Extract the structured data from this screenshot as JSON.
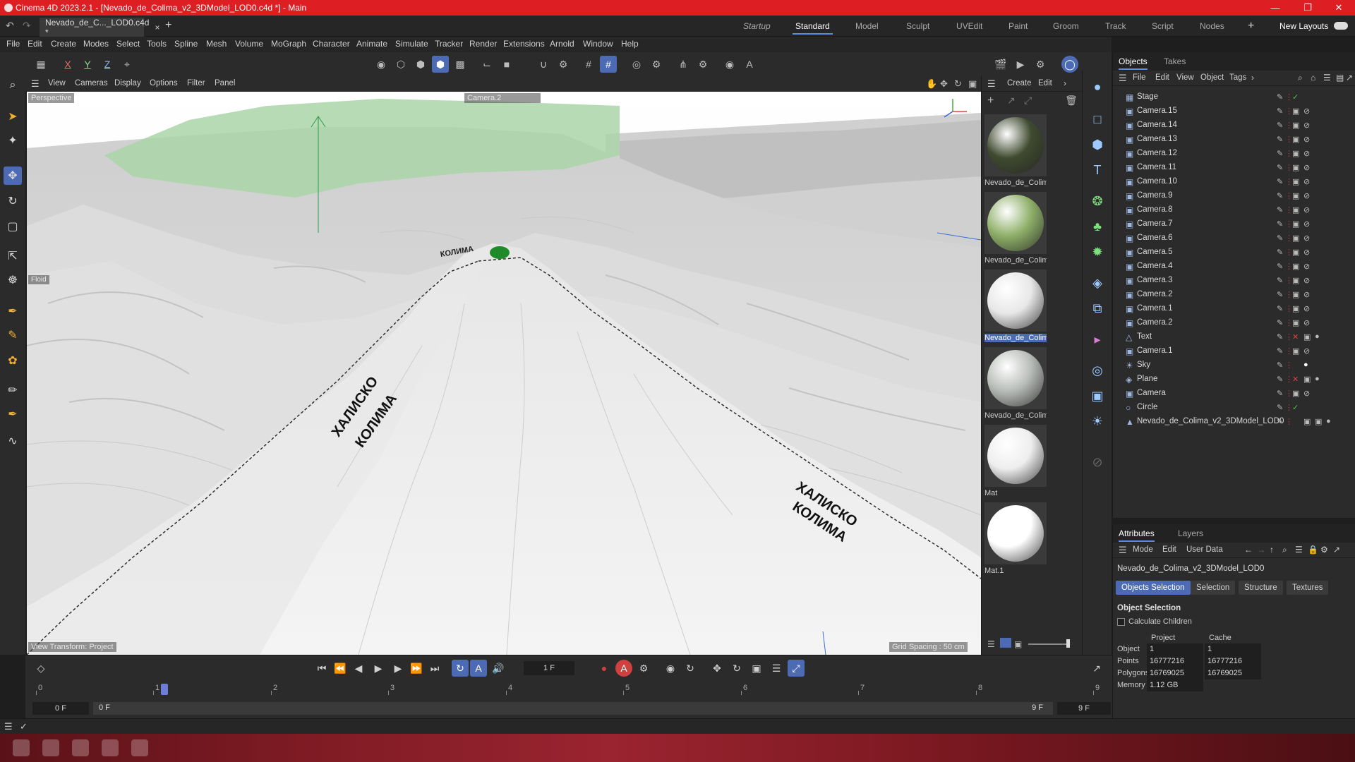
{
  "window": {
    "title": "Cinema 4D 2023.2.1 - [Nevado_de_Colima_v2_3DModel_LOD0.c4d *] - Main",
    "minimize_icon": "minimize-icon",
    "restore_icon": "restore-icon",
    "close_icon": "close-icon"
  },
  "document_tab": {
    "label": "Nevado_de_C..._LOD0.c4d *",
    "close": "×"
  },
  "layouts": {
    "items": [
      "Startup",
      "Standard",
      "Model",
      "Sculpt",
      "UVEdit",
      "Paint",
      "Groom",
      "Track",
      "Script",
      "Nodes"
    ],
    "active": "Standard",
    "add": "+",
    "new_layouts": "New Layouts"
  },
  "menu": [
    "File",
    "Edit",
    "Create",
    "Modes",
    "Select",
    "Tools",
    "Spline",
    "Mesh",
    "Volume",
    "MoGraph",
    "Character",
    "Animate",
    "Simulate",
    "Tracker",
    "Render",
    "Extensions",
    "Arnold",
    "Window",
    "Help"
  ],
  "toolbar": {
    "axis_x": "X",
    "axis_y": "Y",
    "axis_z": "Z"
  },
  "viewport_menu": [
    "View",
    "Cameras",
    "Display",
    "Options",
    "Filter",
    "Panel"
  ],
  "viewport": {
    "view_name": "Perspective",
    "camera_name": "Camera.2",
    "side_label": "Floid",
    "view_transform": "View Transform: Project",
    "grid_spacing": "Grid Spacing : 50 cm",
    "text_left_1": "ХАЛИСКО",
    "text_left_2": "КОЛИМА",
    "text_right_1": "ХАЛИСКО",
    "text_right_2": "КОЛИМА",
    "text_top": "КОЛИМА"
  },
  "material_menu": [
    "Create",
    "Edit"
  ],
  "materials": [
    {
      "name": "Nevado_de_Colim",
      "color": "#3f4a2f",
      "selected": false
    },
    {
      "name": "Nevado_de_Colim",
      "color": "#8fb069",
      "selected": false
    },
    {
      "name": "Nevado_de_Colim",
      "color": "#e8e8e8",
      "selected": true
    },
    {
      "name": "Nevado_de_Colim",
      "color": "#b8bcb8",
      "selected": false
    },
    {
      "name": "Mat",
      "color": "#eeeeee",
      "selected": false
    },
    {
      "name": "Mat.1",
      "color": "#ffffff",
      "selected": false
    }
  ],
  "objects_panel": {
    "tabs": [
      "Objects",
      "Takes"
    ],
    "menu": [
      "File",
      "Edit",
      "View",
      "Object",
      "Tags"
    ],
    "items": [
      {
        "name": "Stage",
        "icon": "stage-icon"
      },
      {
        "name": "Camera.15",
        "icon": "camera-icon"
      },
      {
        "name": "Camera.14",
        "icon": "camera-icon"
      },
      {
        "name": "Camera.13",
        "icon": "camera-icon"
      },
      {
        "name": "Camera.12",
        "icon": "camera-icon"
      },
      {
        "name": "Camera.11",
        "icon": "camera-icon"
      },
      {
        "name": "Camera.10",
        "icon": "camera-icon"
      },
      {
        "name": "Camera.9",
        "icon": "camera-icon"
      },
      {
        "name": "Camera.8",
        "icon": "camera-icon"
      },
      {
        "name": "Camera.7",
        "icon": "camera-icon"
      },
      {
        "name": "Camera.6",
        "icon": "camera-icon"
      },
      {
        "name": "Camera.5",
        "icon": "camera-icon"
      },
      {
        "name": "Camera.4",
        "icon": "camera-icon"
      },
      {
        "name": "Camera.3",
        "icon": "camera-icon"
      },
      {
        "name": "Camera.2",
        "icon": "camera-icon"
      },
      {
        "name": "Camera.1",
        "icon": "camera-icon"
      },
      {
        "name": "Camera.2",
        "icon": "camera-icon"
      },
      {
        "name": "Text",
        "icon": "text-icon"
      },
      {
        "name": "Camera.1",
        "icon": "camera-icon"
      },
      {
        "name": "Sky",
        "icon": "sky-icon"
      },
      {
        "name": "Plane",
        "icon": "plane-icon"
      },
      {
        "name": "Camera",
        "icon": "camera-icon"
      },
      {
        "name": "Circle",
        "icon": "circle-icon"
      },
      {
        "name": "Nevado_de_Colima_v2_3DModel_LOD0",
        "icon": "mesh-icon"
      }
    ]
  },
  "attributes_panel": {
    "tabs": [
      "Attributes",
      "Layers"
    ],
    "menu": [
      "Mode",
      "Edit",
      "User Data"
    ],
    "object_name": "Nevado_de_Colima_v2_3DModel_LOD0",
    "subtabs": [
      "Objects Selection",
      "Selection",
      "Structure",
      "Textures"
    ],
    "active_subtab": "Objects Selection",
    "section_title": "Object Selection",
    "calculate_children": "Calculate Children",
    "col_project": "Project",
    "col_cache": "Cache",
    "rows": [
      {
        "label": "Object",
        "project": "1",
        "cache": "1"
      },
      {
        "label": "Points",
        "project": "16777216",
        "cache": "16777216"
      },
      {
        "label": "Polygons",
        "project": "16769025",
        "cache": "16769025"
      },
      {
        "label": "Memory",
        "project": "1.12 GB",
        "cache": ""
      }
    ]
  },
  "timeline": {
    "current_frame": "1 F",
    "ruler": [
      "0",
      "1",
      "2",
      "3",
      "4",
      "5",
      "6",
      "7",
      "8",
      "9"
    ],
    "start": "0 F",
    "start2": "0 F",
    "end": "9 F",
    "end2": "9 F"
  },
  "colors": {
    "accent": "#4d6bb5",
    "titlebar": "#dd1f24",
    "panel": "#2b2b2b"
  }
}
